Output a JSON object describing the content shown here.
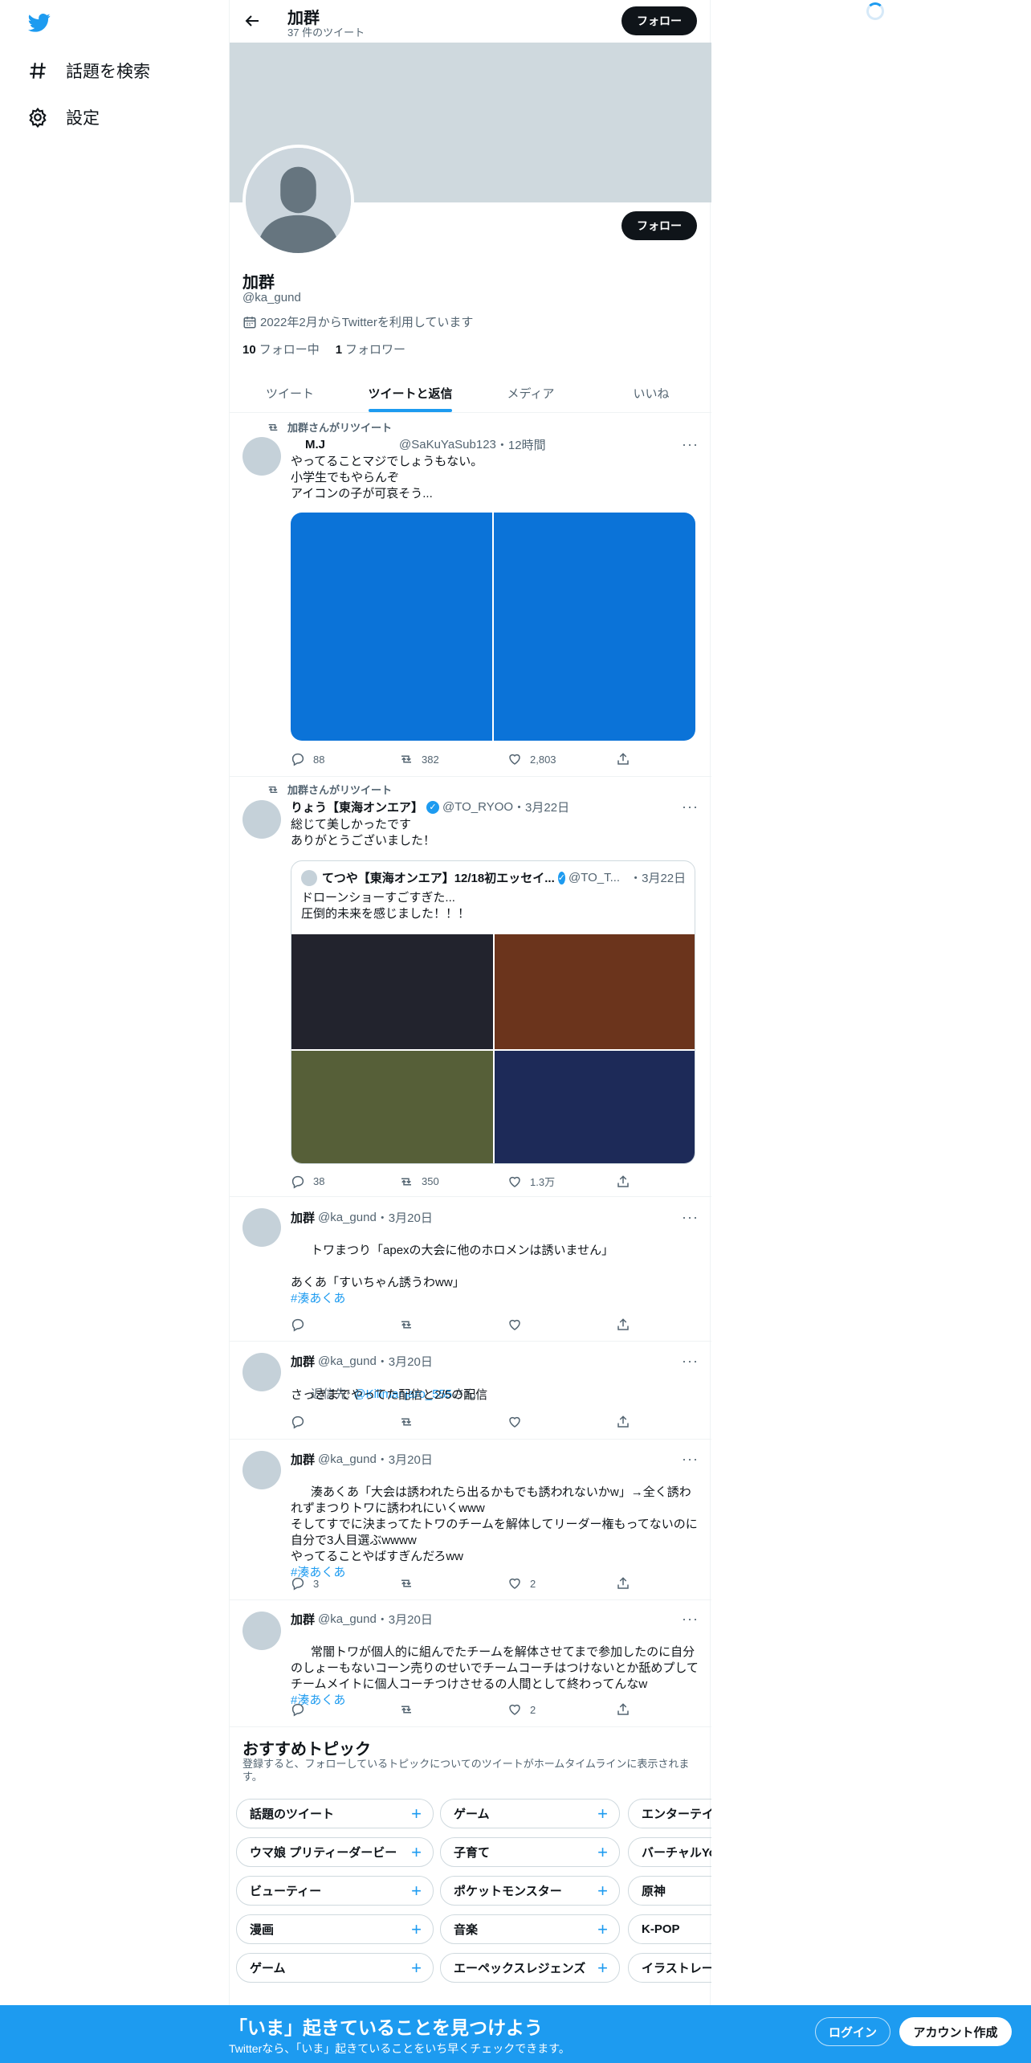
{
  "nav": {
    "explore_label": "話題を検索",
    "settings_label": "設定"
  },
  "header": {
    "name": "加群",
    "tweet_count": "37 件のツイート",
    "follow_label": "フォロー"
  },
  "profile": {
    "name": "加群",
    "handle": "@ka_gund",
    "joined": "2022年2月からTwitterを利用しています",
    "following_count": "10",
    "following_label": "フォロー中",
    "followers_count": "1",
    "followers_label": "フォロワー",
    "follow_label": "フォロー"
  },
  "tabs": [
    {
      "label": "ツイート"
    },
    {
      "label": "ツイートと返信"
    },
    {
      "label": "メディア"
    },
    {
      "label": "いいね"
    }
  ],
  "tweets": [
    {
      "retweet_label": "加群さんがリツイート",
      "name": "M.J",
      "handle": "@SaKuYaSub123",
      "time": "・12時間",
      "text": "やってることマジでしょうもない。\n小学生でもやらんぞ\nアイコンの子が可哀そう...",
      "replies": "88",
      "retweets": "382",
      "likes": "2,803",
      "media_colors": [
        "#0b73d8",
        "#0b73d8"
      ]
    },
    {
      "retweet_label": "加群さんがリツイート",
      "name": "りょう【東海オンエア】",
      "handle": "@TO_RYOO",
      "time": "・3月22日",
      "text": "総じて美しかったです\nありがとうございました！",
      "quote": {
        "name": "てつや【東海オンエア】12/18初エッセイ...",
        "handle": "@TO_T...",
        "time": "・3月22日",
        "text": "ドローンショーすごすぎた...\n圧倒的未来を感じました！！！",
        "media_colors": [
          "#22232d",
          "#6b341c",
          "#565f38",
          "#1d2a58"
        ]
      },
      "replies": "38",
      "retweets": "350",
      "likes": "1.3万"
    },
    {
      "name": "加群",
      "handle": "@ka_gund",
      "time": "・3月20日",
      "text": "トワまつり「apexの大会に他のホロメンは誘いません」\n\nあくあ「すいちゃん誘うわww」\n",
      "hashtag": "#湊あくあ",
      "replies": "",
      "retweets": "",
      "likes": ""
    },
    {
      "name": "加群",
      "handle": "@ka_gund",
      "time": "・3月20日",
      "reply_prefix": "返信先: ",
      "reply_to": "@Kilimanjaro_555",
      "reply_suffix": "さん",
      "text": "さっきまでやってた配信と2/5の配信",
      "replies": "",
      "retweets": "",
      "likes": ""
    },
    {
      "name": "加群",
      "handle": "@ka_gund",
      "time": "・3月20日",
      "text": "湊あくあ「大会は誘われたら出るかもでも誘われないかw」→全く誘われずまつりトワに誘われにいくwww\nそしてすでに決まってたトワのチームを解体してリーダー権もってないのに自分で3人目選ぶwwww\nやってることやばすぎんだろww",
      "hashtag": "#湊あくあ",
      "replies": "3",
      "retweets": "",
      "likes": "2"
    },
    {
      "name": "加群",
      "handle": "@ka_gund",
      "time": "・3月20日",
      "text": "常闇トワが個人的に組んでたチームを解体させてまで参加したのに自分のしょーもないコーン売りのせいでチームコーチはつけないとか舐めプしてチームメイトに個人コーチつけさせるの人間として終わってんなw",
      "hashtag": "#湊あくあ",
      "replies": "",
      "retweets": "",
      "likes": "2"
    }
  ],
  "topics": {
    "title": "おすすめトピック",
    "subtitle": "登録すると、フォローしているトピックについてのツイートがホームタイムラインに表示されます。",
    "rows": [
      [
        "話題のツイート",
        "ゲーム",
        "エンターテイ"
      ],
      [
        "ウマ娘 プリティーダービー",
        "子育て",
        "バーチャルYo"
      ],
      [
        "ビューティー",
        "ポケットモンスター",
        "原神"
      ],
      [
        "漫画",
        "音楽",
        "K-POP"
      ],
      [
        "ゲーム",
        "エーペックスレジェンズ",
        "イラストレー"
      ]
    ]
  },
  "bottom_bar": {
    "title": "「いま」起きていることを見つけよう",
    "subtitle": "Twitterなら、「いま」起きていることをいち早くチェックできます。",
    "login_label": "ログイン",
    "signup_label": "アカウント作成"
  },
  "colors": {
    "accent": "#1d9bf0",
    "text": "#0f1419",
    "muted": "#536471",
    "banner": "#cfd9de"
  }
}
